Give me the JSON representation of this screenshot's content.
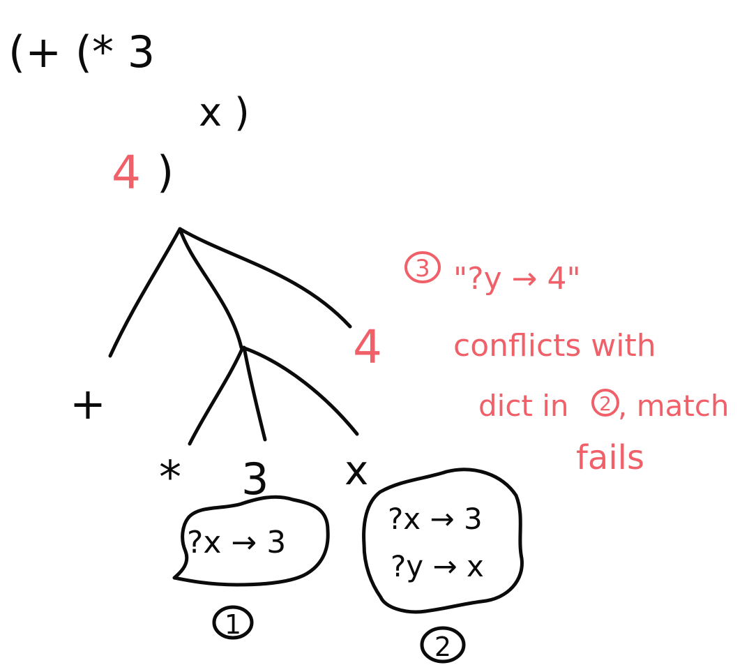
{
  "expression": {
    "line1": "(+  (*  3",
    "line2": "x )",
    "line3_num": "4",
    "line3_paren": ")"
  },
  "tree": {
    "plus": "+",
    "times": "*",
    "three": "3",
    "x": "x",
    "four": "4"
  },
  "clouds": {
    "one": {
      "binding": "?x → 3",
      "label": "1"
    },
    "two": {
      "binding_x": "?x → 3",
      "binding_y": "?y → x",
      "label": "2"
    }
  },
  "note": {
    "marker": "3",
    "quote": "\"?y → 4\"",
    "line2": "conflicts with",
    "line3_a": "dict in",
    "line3_marker": "2",
    "line3_b": ", match",
    "line4": "fails"
  },
  "colors": {
    "ink": "#0b0b0b",
    "accent": "#f06068"
  }
}
